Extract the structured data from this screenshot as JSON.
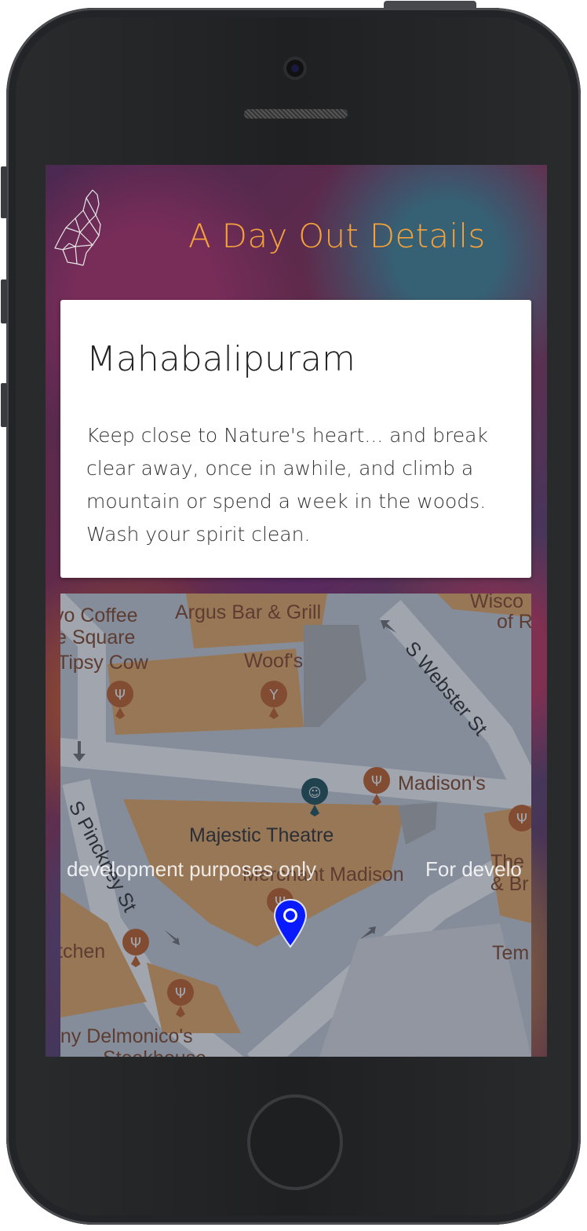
{
  "header": {
    "title": "A Day Out Details",
    "logo_icon": "elephant-geometric-icon"
  },
  "card": {
    "place": "Mahabalipuram",
    "quote": "Keep close to Nature's heart... and break clear away, once in awhile, and climb a mountain or spend a week in the woods. Wash your spirit clean."
  },
  "map": {
    "labels": {
      "coffee": "vo Coffee",
      "square": "e Square",
      "tipsy": "Tipsy Cow",
      "argus": "Argus Bar & Grill",
      "woofs": "Woof's",
      "wisco": "Wisco",
      "ofr": "of R",
      "webster": "S Webster St",
      "madisons": "Madison's",
      "pinckney": "S Pinckney St",
      "majestic": "Majestic Theatre",
      "merchant": "Merchant Madison",
      "the": "The",
      "br": "& Br",
      "kitchen": "tchen",
      "tem": "Tem",
      "delmonico": "nny Delmonico's",
      "steakhouse": "Steakhouse"
    },
    "watermark_left": "development purposes only",
    "watermark_right": "For develo",
    "pin_icon": "map-pin-icon",
    "colors": {
      "building": "#f0b06a",
      "road": "#ffffff",
      "block": "#cfd6e0",
      "pin": "#0a1aff",
      "poi": "#c8662a",
      "theatre": "#23565e"
    }
  }
}
